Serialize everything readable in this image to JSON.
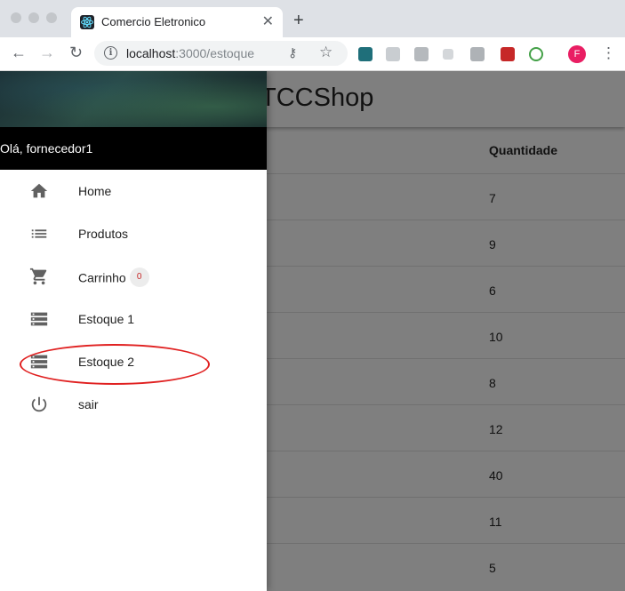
{
  "browser": {
    "tab_title": "Comercio Eletronico",
    "tab_close": "✕",
    "new_tab": "+",
    "url_host": "localhost",
    "url_rest": ":3000/estoque",
    "avatar_letter": "F",
    "back": "←",
    "forward": "→",
    "reload": "↻",
    "info": "i",
    "key": "⚷",
    "star": "☆",
    "menu": "⋮"
  },
  "app": {
    "brand": "TCCShop"
  },
  "table": {
    "header": "Quantidade",
    "rows": [
      "7",
      "9",
      "6",
      "10",
      "8",
      "12",
      "40",
      "11",
      "5"
    ]
  },
  "drawer": {
    "greeting": "Olá, fornecedor1",
    "items": [
      {
        "label": "Home",
        "icon": "home-icon"
      },
      {
        "label": "Produtos",
        "icon": "list-icon"
      },
      {
        "label": "Carrinho",
        "icon": "cart-icon",
        "badge": "0"
      },
      {
        "label": "Estoque 1",
        "icon": "storage-icon"
      },
      {
        "label": "Estoque 2",
        "icon": "storage-icon"
      },
      {
        "label": "sair",
        "icon": "power-icon"
      }
    ]
  },
  "colors": {
    "highlight": "#e02020",
    "avatar": "#e91e63",
    "badge_text": "#c62828"
  }
}
